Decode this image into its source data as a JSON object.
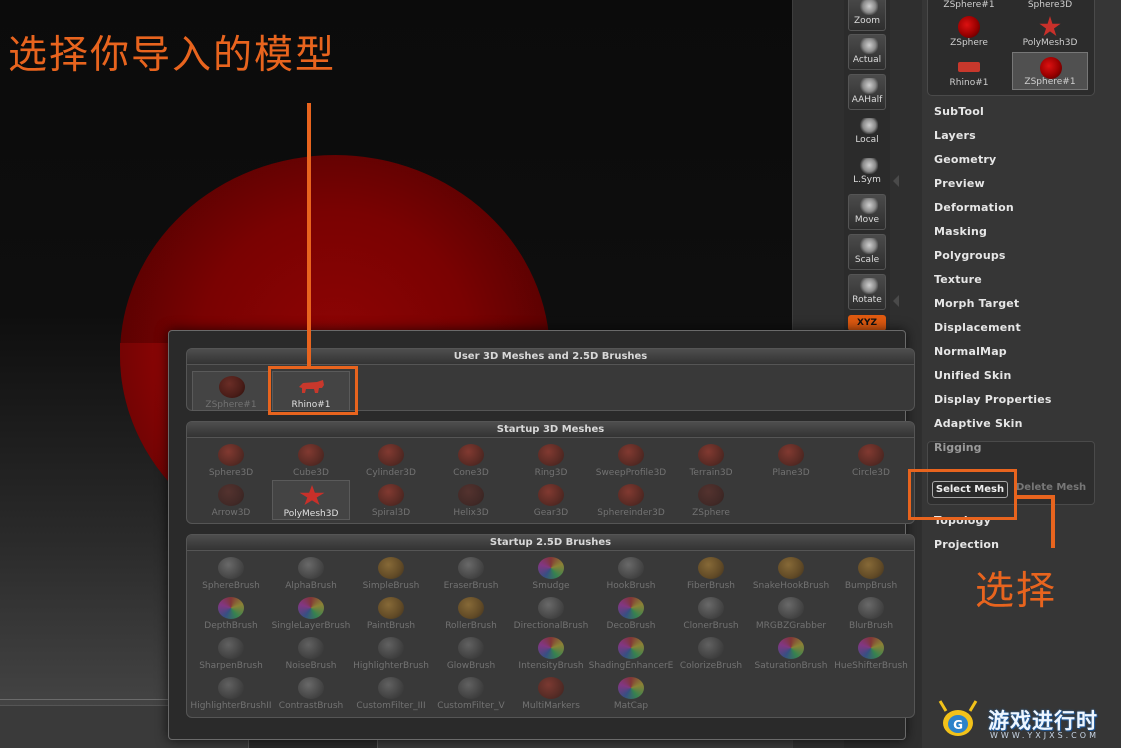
{
  "annotations": {
    "title": "选择你导入的模型",
    "select": "选择",
    "color": "#e8641e"
  },
  "shelf": {
    "buttons": [
      {
        "name": "zoom",
        "label": "Zoom",
        "icon": "zoom-icon"
      },
      {
        "name": "actual",
        "label": "Actual",
        "icon": "actual-size-icon"
      },
      {
        "name": "aahalf",
        "label": "AAHalf",
        "icon": "aahalf-icon"
      },
      {
        "name": "local",
        "label": "Local",
        "icon": "local-pivot-icon"
      },
      {
        "name": "lsym",
        "label": "L.Sym",
        "icon": "local-symmetry-icon"
      },
      {
        "name": "move",
        "label": "Move",
        "icon": "hand-move-icon"
      },
      {
        "name": "scale",
        "label": "Scale",
        "icon": "scale-icon"
      },
      {
        "name": "rotate",
        "label": "Rotate",
        "icon": "rotate-icon"
      }
    ],
    "xyz_label": "XYZ"
  },
  "tool_grid": {
    "items": [
      {
        "label": "ZSphere#1",
        "icon": "zsphere-thumb"
      },
      {
        "label": "Sphere3D",
        "icon": "sphere-thumb"
      },
      {
        "label": "ZSphere",
        "icon": "zsphere-thumb"
      },
      {
        "label": "PolyMesh3D",
        "icon": "polymesh-star-thumb"
      },
      {
        "label": "Rhino#1",
        "icon": "rhino-thumb"
      },
      {
        "label": "ZSphere#1",
        "icon": "zsphere-thumb",
        "selected": true
      }
    ]
  },
  "tool_menu": {
    "items": [
      "SubTool",
      "Layers",
      "Geometry",
      "Preview",
      "Deformation",
      "Masking",
      "Polygroups",
      "Texture",
      "Morph Target",
      "Displacement",
      "NormalMap",
      "Unified Skin",
      "Display Properties",
      "Adaptive Skin"
    ],
    "rigging": "Rigging",
    "select_mesh": "Select Mesh",
    "delete_mesh": "Delete Mesh",
    "after": [
      "Topology",
      "Projection"
    ]
  },
  "popup": {
    "user_section": {
      "title": "User 3D Meshes and 2.5D Brushes",
      "items": [
        {
          "label": "ZSphere#1",
          "thumb": "t-red"
        },
        {
          "label": "Rhino#1",
          "thumb": "rhino",
          "active": true
        }
      ]
    },
    "startup_meshes": {
      "title": "Startup 3D Meshes",
      "items": [
        "Sphere3D",
        "Cube3D",
        "Cylinder3D",
        "Cone3D",
        "Ring3D",
        "SweepProfile3D",
        "Terrain3D",
        "Plane3D",
        "Circle3D",
        "Arrow3D",
        "PolyMesh3D",
        "Spiral3D",
        "Helix3D",
        "Gear3D",
        "Sphereinder3D",
        "ZSphere"
      ]
    },
    "startup_brushes": {
      "title": "Startup 2.5D Brushes",
      "items": [
        "SphereBrush",
        "AlphaBrush",
        "SimpleBrush",
        "EraserBrush",
        "Smudge",
        "HookBrush",
        "FiberBrush",
        "SnakeHookBrush",
        "BumpBrush",
        "DepthBrush",
        "SingleLayerBrush",
        "PaintBrush",
        "RollerBrush",
        "DirectionalBrush",
        "DecoBrush",
        "ClonerBrush",
        "MRGBZGrabber",
        "BlurBrush",
        "SharpenBrush",
        "NoiseBrush",
        "HighlighterBrush",
        "GlowBrush",
        "IntensityBrush",
        "ShadingEnhancerE",
        "ColorizeBrush",
        "SaturationBrush",
        "HueShifterBrush",
        "HighlighterBrushII",
        "ContrastBrush",
        "CustomFilter_III",
        "CustomFilter_V",
        "MultiMarkers",
        "MatCap"
      ]
    }
  },
  "watermark": {
    "text": "游戏进行时",
    "url": "WWW.YXJXS.COM"
  }
}
